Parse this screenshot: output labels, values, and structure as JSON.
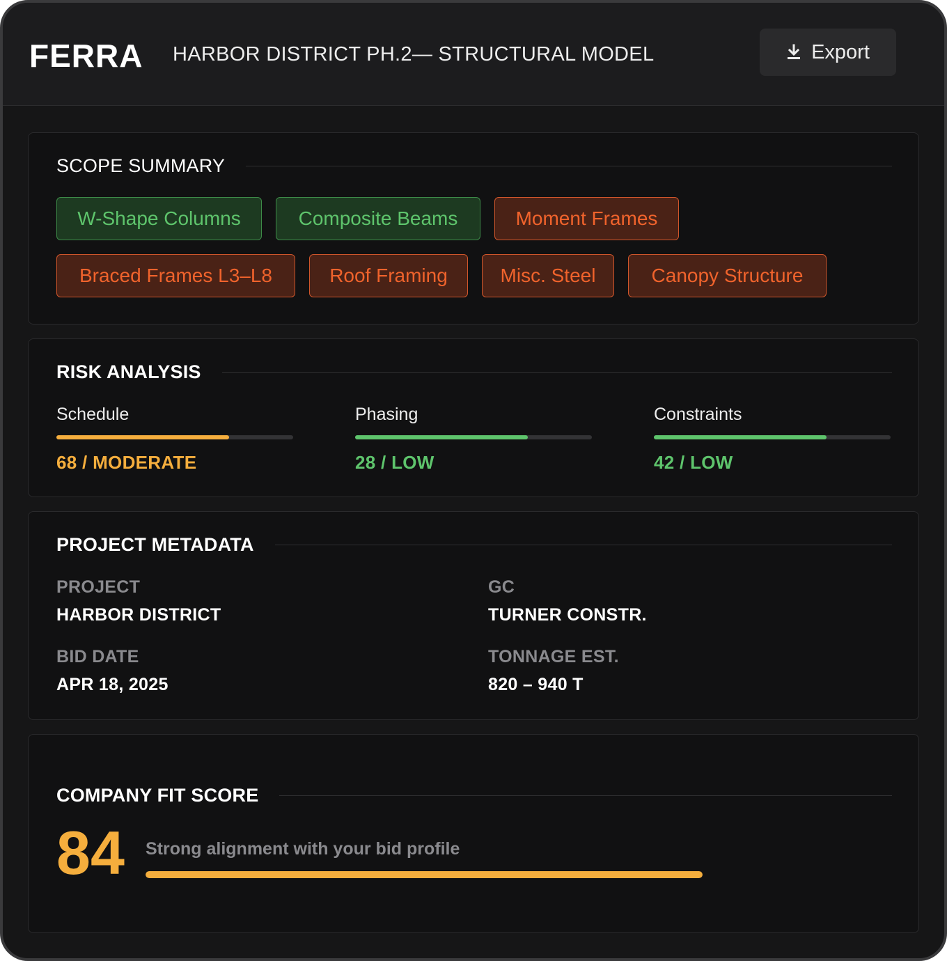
{
  "header": {
    "brand": "FERRA",
    "title": "HARBOR DISTRICT PH.2— STRUCTURAL MODEL",
    "export_label": "Export",
    "export_icon": "download-icon"
  },
  "scope": {
    "title": "SCOPE SUMMARY",
    "tags": [
      {
        "label": "W-Shape Columns",
        "status": "green"
      },
      {
        "label": "Composite Beams",
        "status": "green"
      },
      {
        "label": "Moment Frames",
        "status": "orange"
      },
      {
        "label": "Braced Frames L3–L8",
        "status": "orange"
      },
      {
        "label": "Roof Framing",
        "status": "orange"
      },
      {
        "label": "Misc. Steel",
        "status": "orange"
      },
      {
        "label": "Canopy Structure",
        "status": "orange"
      }
    ]
  },
  "risk": {
    "title": "RISK ANALYSIS",
    "items": [
      {
        "label": "Schedule",
        "value_text": "68 / MODERATE",
        "fill": 0.73,
        "color": "#f5ae3d"
      },
      {
        "label": "Phasing",
        "value_text": "28 / LOW",
        "fill": 0.73,
        "color": "#5ec46c"
      },
      {
        "label": "Constraints",
        "value_text": "42 / LOW",
        "fill": 0.73,
        "color": "#5ec46c"
      }
    ]
  },
  "metadata": {
    "title": "PROJECT METADATA",
    "fields": [
      {
        "key": "PROJECT",
        "value": "HARBOR DISTRICT"
      },
      {
        "key": "GC",
        "value": "TURNER CONSTR."
      },
      {
        "key": "BID DATE",
        "value": "APR 18, 2025"
      },
      {
        "key": "TONNAGE EST.",
        "value": "820 – 940 T"
      }
    ]
  },
  "fit": {
    "title": "COMPANY FIT SCORE",
    "score": "84",
    "description": "Strong alignment with your bid profile",
    "fill": 1.0,
    "color": "#f5ae3d"
  },
  "colors": {
    "green": "#5ec46c",
    "orange": "#f0632c",
    "amber": "#f5ae3d",
    "background": "#161617"
  }
}
